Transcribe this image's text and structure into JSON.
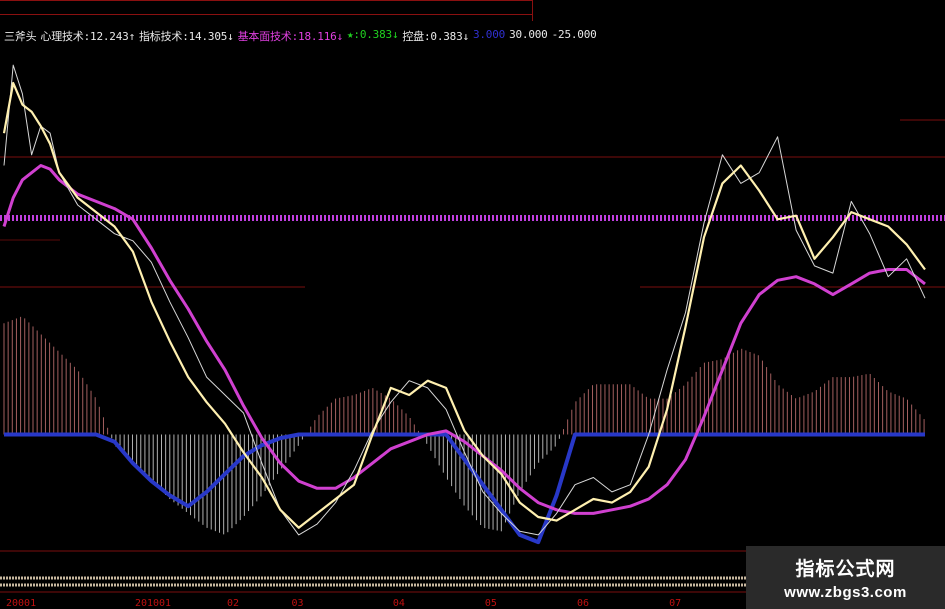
{
  "legend": {
    "name": "三斧头",
    "items": [
      {
        "label": "心理技术:",
        "value": "12.243",
        "arrow": "↑",
        "color": "#e8e8e8"
      },
      {
        "label": "指标技术:",
        "value": "14.305",
        "arrow": "↓",
        "color": "#e8e8e8"
      },
      {
        "label": "基本面技术:",
        "value": "18.116",
        "arrow": "↓",
        "color": "#e040e0"
      },
      {
        "label": "★:",
        "value": "0.383",
        "arrow": "↓",
        "color": "#20d020"
      },
      {
        "label": "控盘:",
        "value": "0.383",
        "arrow": "↓",
        "color": "#e8e8e8"
      },
      {
        "label": "",
        "value": "3.000",
        "arrow": "",
        "color": "#3030d0"
      },
      {
        "label": "",
        "value": "30.000",
        "arrow": "",
        "color": "#e8e8e8"
      },
      {
        "label": "",
        "value": "-25.000",
        "arrow": "",
        "color": "#e8e8e8"
      }
    ]
  },
  "watermark": {
    "line1": "指标公式网",
    "line2": "www.zbgs3.com"
  },
  "chart_data": {
    "type": "line",
    "x_tick_labels": [
      "20001",
      "201001",
      "02",
      "03",
      "04",
      "05",
      "06",
      "07"
    ],
    "ylim": [
      -35,
      110
    ],
    "hlines": {
      "purple_dotted": 70,
      "blue_zero": 0
    },
    "series": [
      {
        "key": "thin_white",
        "color": "#d8d8d8",
        "x": [
          0,
          1,
          2,
          3,
          4,
          5,
          6,
          8,
          10,
          12,
          14,
          16,
          18,
          20,
          22,
          24,
          26,
          28,
          30,
          32,
          34,
          36,
          38,
          40,
          42,
          44,
          46,
          48,
          50,
          52,
          54,
          56,
          58,
          60,
          62,
          64,
          66,
          68,
          70,
          72,
          74,
          76,
          78,
          80,
          82,
          84,
          86,
          88,
          90,
          92,
          94,
          96,
          98,
          100
        ],
        "y": [
          75,
          103,
          95,
          78,
          86,
          84,
          73,
          64,
          60,
          56,
          54,
          48,
          37,
          27,
          16,
          11,
          6,
          -8,
          -21,
          -28,
          -25,
          -19,
          -10,
          1,
          9,
          15,
          13,
          7,
          -5,
          -16,
          -22,
          -27,
          -28,
          -22,
          -14,
          -12,
          -16,
          -14,
          0,
          18,
          34,
          59,
          78,
          70,
          73,
          83,
          57,
          47,
          45,
          65,
          56,
          44,
          49,
          38
        ]
      },
      {
        "key": "yellow",
        "color": "#fff0b0",
        "x": [
          0,
          1,
          2,
          3,
          4,
          5,
          6,
          8,
          10,
          12,
          14,
          16,
          18,
          20,
          22,
          24,
          26,
          28,
          30,
          32,
          34,
          36,
          38,
          40,
          42,
          44,
          46,
          48,
          50,
          52,
          54,
          56,
          58,
          60,
          62,
          64,
          66,
          68,
          70,
          72,
          74,
          76,
          78,
          80,
          82,
          84,
          86,
          88,
          90,
          92,
          94,
          96,
          98,
          100
        ],
        "y": [
          84,
          98,
          92,
          90,
          86,
          81,
          73,
          66,
          62,
          58,
          51,
          37,
          26,
          16,
          9,
          3,
          -5,
          -12,
          -21,
          -26,
          -22,
          -18,
          -14,
          0,
          13,
          11,
          15,
          13,
          1,
          -6,
          -11,
          -19,
          -23,
          -24,
          -21,
          -18,
          -19,
          -16,
          -9,
          7,
          30,
          55,
          70,
          75,
          68,
          60,
          61,
          49,
          55,
          62,
          60,
          58,
          53,
          46
        ]
      },
      {
        "key": "magenta",
        "color": "#d040d0",
        "x": [
          0,
          1,
          2,
          3,
          4,
          5,
          6,
          8,
          10,
          12,
          14,
          16,
          18,
          20,
          22,
          24,
          26,
          28,
          30,
          32,
          34,
          36,
          38,
          40,
          42,
          44,
          46,
          48,
          50,
          52,
          54,
          56,
          58,
          60,
          62,
          64,
          66,
          68,
          70,
          72,
          74,
          76,
          78,
          80,
          82,
          84,
          86,
          88,
          90,
          92,
          94,
          96,
          98,
          100
        ],
        "y": [
          58,
          66,
          71,
          73,
          75,
          74,
          71,
          67,
          65,
          63,
          60,
          52,
          43,
          35,
          26,
          18,
          8,
          -1,
          -8,
          -13,
          -15,
          -15,
          -12,
          -8,
          -4,
          -2,
          0,
          1,
          -2,
          -6,
          -10,
          -15,
          -19,
          -21,
          -22,
          -22,
          -21,
          -20,
          -18,
          -14,
          -7,
          5,
          18,
          31,
          39,
          43,
          44,
          42,
          39,
          42,
          45,
          46,
          46,
          42
        ]
      },
      {
        "key": "blue",
        "color": "#2838c8",
        "x": [
          0,
          2,
          4,
          6,
          8,
          10,
          12,
          14,
          16,
          18,
          20,
          22,
          24,
          26,
          28,
          30,
          32,
          34,
          36,
          38,
          40,
          42,
          44,
          46,
          48,
          50,
          52,
          54,
          56,
          58,
          60,
          62,
          64,
          66,
          68,
          70,
          100
        ],
        "y": [
          0,
          0,
          0,
          0,
          0,
          0,
          -2,
          -8,
          -13,
          -17,
          -20,
          -16,
          -11,
          -6,
          -3,
          -1,
          0,
          0,
          0,
          0,
          0,
          0,
          0,
          0,
          0,
          -7,
          -14,
          -21,
          -28,
          -30,
          -17,
          0,
          0,
          0,
          0,
          0,
          0
        ]
      },
      {
        "key": "histogram",
        "color_pos": "#c07070",
        "color_neg": "#d0d0d0",
        "x": [
          0,
          2,
          4,
          6,
          8,
          10,
          12,
          14,
          16,
          18,
          20,
          22,
          24,
          26,
          28,
          30,
          32,
          34,
          36,
          38,
          40,
          42,
          44,
          46,
          48,
          50,
          52,
          54,
          56,
          58,
          60,
          62,
          64,
          66,
          68,
          70,
          72,
          74,
          76,
          78,
          80,
          82,
          84,
          86,
          88,
          90,
          92,
          94,
          96,
          98,
          100
        ],
        "y": [
          31,
          33,
          28,
          23,
          18,
          10,
          -3,
          -8,
          -13,
          -18,
          -22,
          -26,
          -28,
          -23,
          -17,
          -10,
          -3,
          5,
          10,
          11,
          13,
          10,
          5,
          -3,
          -12,
          -20,
          -26,
          -27,
          -16,
          -8,
          -3,
          9,
          14,
          14,
          14,
          10,
          10,
          14,
          20,
          21,
          24,
          22,
          14,
          10,
          12,
          16,
          16,
          17,
          12,
          10,
          4
        ]
      }
    ]
  }
}
